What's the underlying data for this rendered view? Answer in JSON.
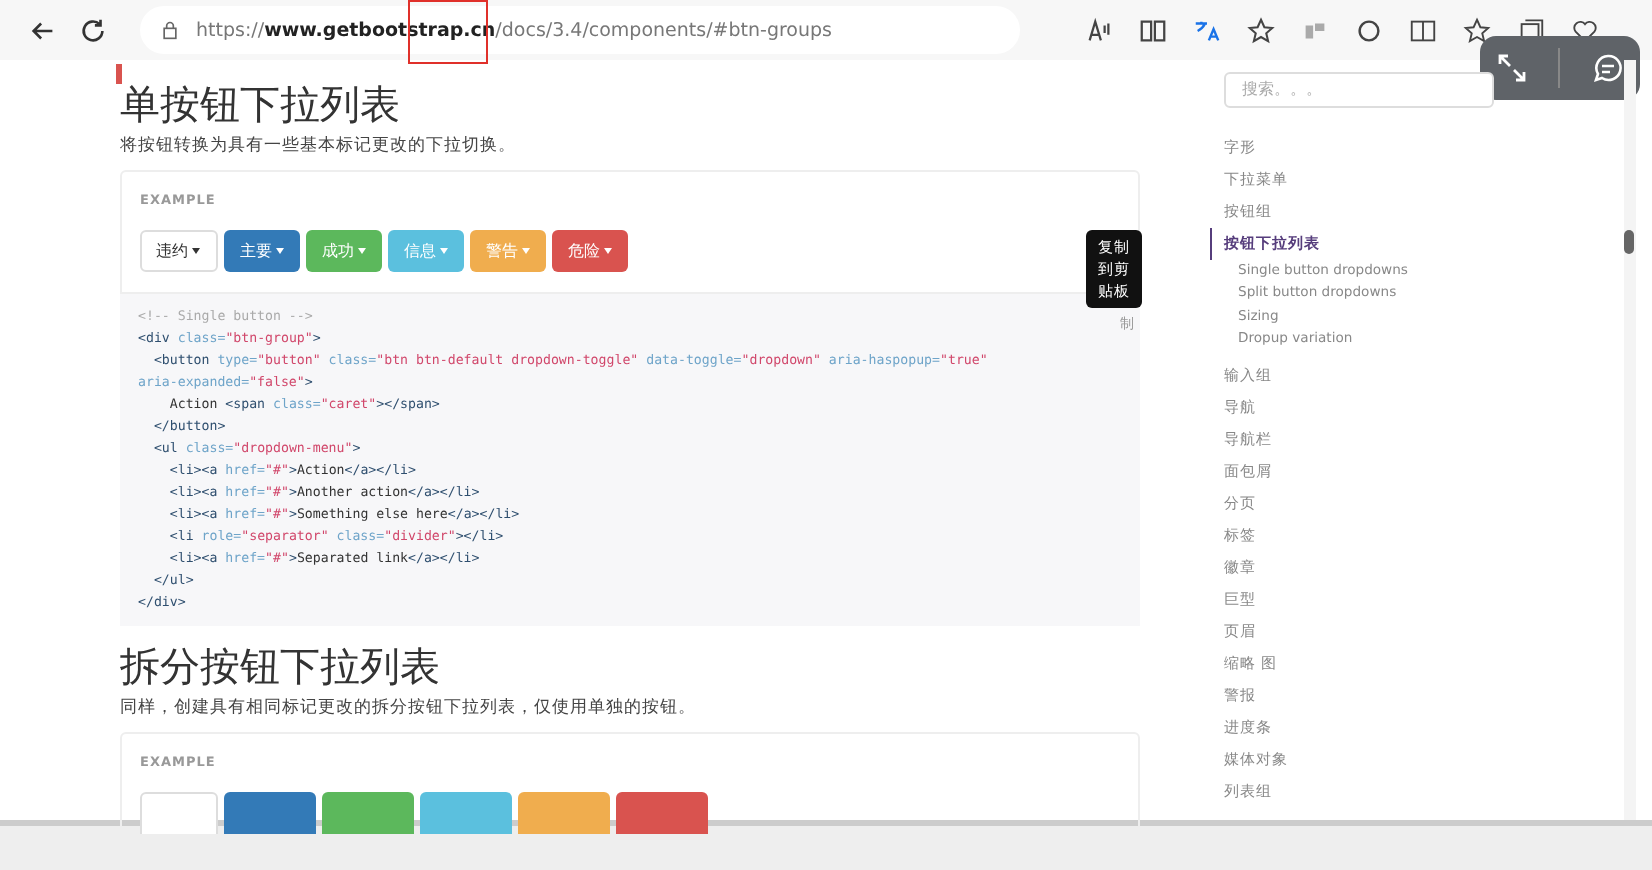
{
  "browser": {
    "url_parts": [
      {
        "text": "https://",
        "bold": false
      },
      {
        "text": "www.getbootstrap.cn",
        "bold": true
      },
      {
        "text": "/docs/3.4/components/#btn-groups",
        "bold": false
      }
    ]
  },
  "sections": [
    {
      "title": "单按钮下拉列表",
      "description": "将按钮转换为具有一些基本标记更改的下拉切换。",
      "example_label": "EXAMPLE",
      "buttons": [
        {
          "label": "违约",
          "kind": "default"
        },
        {
          "label": "主要",
          "kind": "primary"
        },
        {
          "label": "成功",
          "kind": "success"
        },
        {
          "label": "信息",
          "kind": "info"
        },
        {
          "label": "警告",
          "kind": "warning"
        },
        {
          "label": "危险",
          "kind": "danger"
        }
      ],
      "tooltip": {
        "lines": [
          "复制",
          "到剪",
          "贴板"
        ]
      },
      "copy_button": "制",
      "code": [
        [
          {
            "kind": "comment",
            "text": "<!-- Single button -->"
          }
        ],
        [
          {
            "kind": "tag",
            "text": "<div"
          },
          {
            "kind": "attr",
            "text": " class="
          },
          {
            "kind": "string",
            "text": "\"btn-group\""
          },
          {
            "kind": "tag",
            "text": ">"
          }
        ],
        [
          {
            "kind": "tag",
            "text": "  <button"
          },
          {
            "kind": "attr",
            "text": " type="
          },
          {
            "kind": "string",
            "text": "\"button\""
          },
          {
            "kind": "attr",
            "text": " class="
          },
          {
            "kind": "string",
            "text": "\"btn btn-default dropdown-toggle\""
          },
          {
            "kind": "attr",
            "text": " data-toggle="
          },
          {
            "kind": "string",
            "text": "\"dropdown\""
          },
          {
            "kind": "attr",
            "text": " aria-haspopup="
          },
          {
            "kind": "string",
            "text": "\"true\""
          }
        ],
        [
          {
            "kind": "attr",
            "text": "aria-expanded="
          },
          {
            "kind": "string",
            "text": "\"false\""
          },
          {
            "kind": "tag",
            "text": ">"
          }
        ],
        [
          {
            "kind": "text",
            "text": "    Action "
          },
          {
            "kind": "tag",
            "text": "<span"
          },
          {
            "kind": "attr",
            "text": " class="
          },
          {
            "kind": "string",
            "text": "\"caret\""
          },
          {
            "kind": "tag",
            "text": "></span>"
          }
        ],
        [
          {
            "kind": "tag",
            "text": "  </button>"
          }
        ],
        [
          {
            "kind": "tag",
            "text": "  <ul"
          },
          {
            "kind": "attr",
            "text": " class="
          },
          {
            "kind": "string",
            "text": "\"dropdown-menu\""
          },
          {
            "kind": "tag",
            "text": ">"
          }
        ],
        [
          {
            "kind": "tag",
            "text": "    <li><a"
          },
          {
            "kind": "attr",
            "text": " href="
          },
          {
            "kind": "string",
            "text": "\"#\""
          },
          {
            "kind": "tag",
            "text": ">"
          },
          {
            "kind": "text",
            "text": "Action"
          },
          {
            "kind": "tag",
            "text": "</a></li>"
          }
        ],
        [
          {
            "kind": "tag",
            "text": "    <li><a"
          },
          {
            "kind": "attr",
            "text": " href="
          },
          {
            "kind": "string",
            "text": "\"#\""
          },
          {
            "kind": "tag",
            "text": ">"
          },
          {
            "kind": "text",
            "text": "Another action"
          },
          {
            "kind": "tag",
            "text": "</a></li>"
          }
        ],
        [
          {
            "kind": "tag",
            "text": "    <li><a"
          },
          {
            "kind": "attr",
            "text": " href="
          },
          {
            "kind": "string",
            "text": "\"#\""
          },
          {
            "kind": "tag",
            "text": ">"
          },
          {
            "kind": "text",
            "text": "Something else here"
          },
          {
            "kind": "tag",
            "text": "</a></li>"
          }
        ],
        [
          {
            "kind": "tag",
            "text": "    <li"
          },
          {
            "kind": "attr",
            "text": " role="
          },
          {
            "kind": "string",
            "text": "\"separator\""
          },
          {
            "kind": "attr",
            "text": " class="
          },
          {
            "kind": "string",
            "text": "\"divider\""
          },
          {
            "kind": "tag",
            "text": "></li>"
          }
        ],
        [
          {
            "kind": "tag",
            "text": "    <li><a"
          },
          {
            "kind": "attr",
            "text": " href="
          },
          {
            "kind": "string",
            "text": "\"#\""
          },
          {
            "kind": "tag",
            "text": ">"
          },
          {
            "kind": "text",
            "text": "Separated link"
          },
          {
            "kind": "tag",
            "text": "</a></li>"
          }
        ],
        [
          {
            "kind": "tag",
            "text": "  </ul>"
          }
        ],
        [
          {
            "kind": "tag",
            "text": "</div>"
          }
        ]
      ]
    },
    {
      "title": "拆分按钮下拉列表",
      "description": "同样，创建具有相同标记更改的拆分按钮下拉列表，仅使用单独的按钮。",
      "example_label": "EXAMPLE",
      "buttons": [
        {
          "kind": "default"
        },
        {
          "kind": "primary"
        },
        {
          "kind": "success"
        },
        {
          "kind": "info"
        },
        {
          "kind": "warning"
        },
        {
          "kind": "danger"
        }
      ]
    }
  ],
  "sidebar": {
    "search": {
      "placeholder": "搜索。。。"
    },
    "items": [
      {
        "label": "字形",
        "selected": false
      },
      {
        "label": "下拉菜单",
        "selected": false
      },
      {
        "label": "按钮组",
        "selected": false
      },
      {
        "label": "按钮下拉列表",
        "selected": true,
        "children": [
          {
            "label": "Single button dropdowns"
          },
          {
            "label": "Split button dropdowns"
          },
          {
            "label": "Sizing"
          },
          {
            "label": "Dropup variation"
          }
        ]
      },
      {
        "label": "输入组",
        "selected": false
      },
      {
        "label": "导航",
        "selected": false
      },
      {
        "label": "导航栏",
        "selected": false
      },
      {
        "label": "面包屑",
        "selected": false
      },
      {
        "label": "分页",
        "selected": false
      },
      {
        "label": "标签",
        "selected": false
      },
      {
        "label": "徽章",
        "selected": false
      },
      {
        "label": "巨型",
        "selected": false
      },
      {
        "label": "页眉",
        "selected": false
      },
      {
        "label": "缩略 图",
        "selected": false
      },
      {
        "label": "警报",
        "selected": false
      },
      {
        "label": "进度条",
        "selected": false
      },
      {
        "label": "媒体对象",
        "selected": false
      },
      {
        "label": "列表组",
        "selected": false
      }
    ]
  }
}
